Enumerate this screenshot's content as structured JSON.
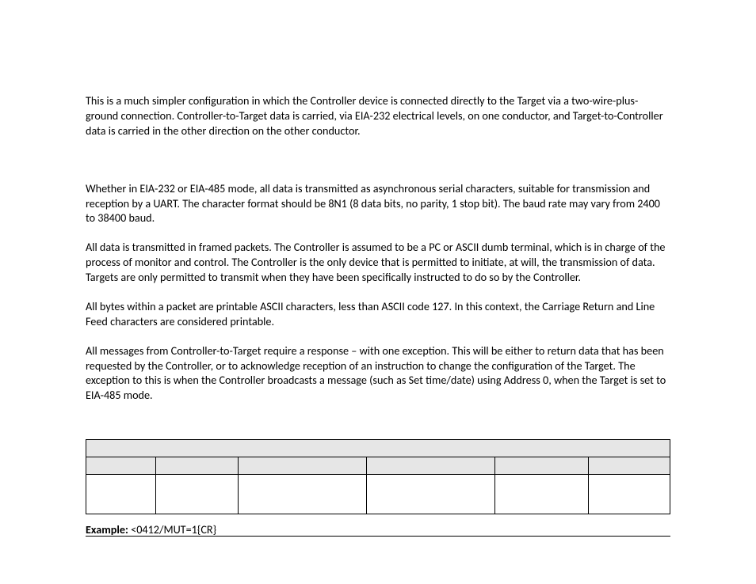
{
  "paragraphs": {
    "p1": "This is a much simpler configuration in which the Controller device is connected directly to the Target via a two-wire-plus-ground connection. Controller-to-Target data is carried, via EIA-232 electrical levels, on one conductor, and Target-to-Controller data is carried in the other direction on the other conductor.",
    "p2": "Whether in EIA-232 or EIA-485 mode, all data is transmitted as asynchronous serial characters, suitable for transmission and reception by a UART. The character format should be 8N1 (8 data bits, no parity, 1 stop bit). The baud rate may vary from 2400 to 38400 baud.",
    "p3": "All data is transmitted in framed packets. The Controller is assumed to be a PC or ASCII dumb terminal, which is in charge of the process of monitor and control. The Controller is the only device that is permitted to initiate, at will, the transmission of data. Targets are only permitted to transmit when they have been specifically instructed to do so by the Controller.",
    "p4": "All bytes within a packet are printable ASCII characters, less than ASCII code 127. In this context, the Carriage Return and Line Feed characters are considered printable.",
    "p5": "All messages from Controller-to-Target require a response – with one exception. This will be either to return data that has been requested by the Controller, or to acknowledge reception of an instruction to change the configuration of the Target. The exception to this is when the Controller broadcasts a message (such as Set time/date) using Address 0, when the Target is set to EIA-485 mode."
  },
  "table": {
    "header_merged": "",
    "headers": [
      "",
      "",
      "",
      "",
      "",
      ""
    ],
    "row": [
      "",
      "",
      "",
      "",
      "",
      ""
    ]
  },
  "example": {
    "label": "Example:",
    "value": "<0412/MUT=1{CR}"
  }
}
